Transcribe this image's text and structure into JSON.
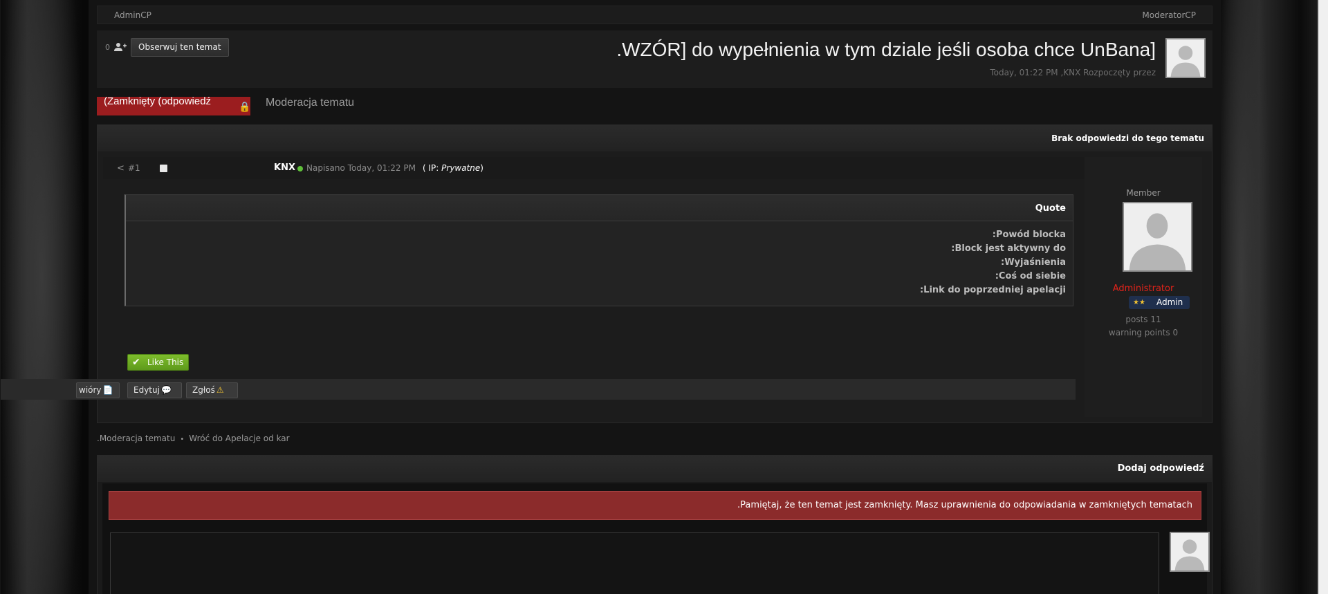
{
  "topbar": {
    "left": "AdminCP",
    "right": "ModeratorCP"
  },
  "header": {
    "follower_count": "0",
    "follow_label": "Obserwuj ten temat",
    "title": ".WZÓR] do wypełnienia w tym dziale jeśli osoba chce UnBana]",
    "meta": "Today, 01:22 PM ,KNX Rozpoczęty przez"
  },
  "tabs": {
    "closed": "(Zamknięty (odpowiedź",
    "moderation": "Moderacja tematu"
  },
  "post_section": {
    "header": "Brak odpowiedzi do tego tematu"
  },
  "post": {
    "number": "#1",
    "author": "KNX",
    "date": "Napisano Today, 01:22 PM",
    "ip_prefix": "( IP:",
    "ip_value": "Prywatne",
    "ip_suffix": ")",
    "quote_title": "Quote",
    "quote_lines": [
      ":Powód blocka",
      ":Block jest aktywny do",
      ":Wyjaśnienia",
      ":Coś od siebie",
      ":Link do poprzedniej apelacji"
    ],
    "like_label": "Like This",
    "actions": [
      "wióry",
      "Edytuj",
      "Zgłoś"
    ]
  },
  "author_panel": {
    "rank": "Member",
    "role": "Administrator",
    "badge": "Admin",
    "posts": "posts 11",
    "warnings": "warning points 0"
  },
  "breadcrumb": {
    "items": [
      ".Moderacja tematu",
      "Wróć do Apelacje od kar"
    ]
  },
  "reply": {
    "header": "Dodaj odpowiedź",
    "notice": ".Pamiętaj, że ten temat jest zamknięty. Masz uprawnienia do odpowiadania w zamkniętych tematach"
  },
  "colors": {
    "closed_tab": "#9b1d1f",
    "like_button": "#6fae23",
    "notice": "#8b2b2b",
    "role_text": "#e2231a"
  }
}
